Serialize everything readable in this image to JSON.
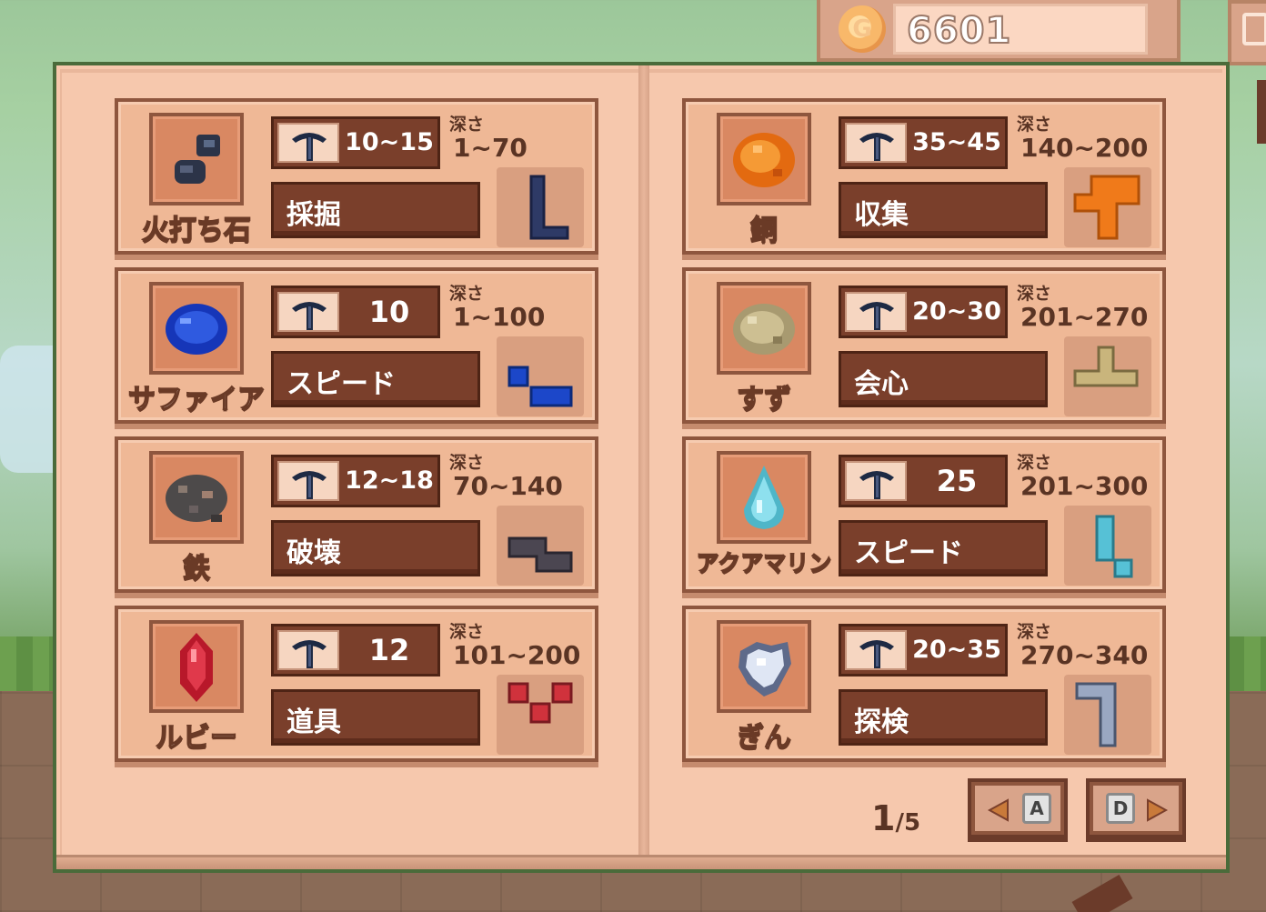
{
  "currency": {
    "amount": "6601",
    "icon": "coin-icon",
    "symbol": "G"
  },
  "depth_label": "深さ",
  "cards": [
    {
      "name": "火打ち石",
      "power": "10~15",
      "depth": "1~70",
      "skill": "採掘",
      "item_icon": "flint-icon",
      "shape_icon": "l-shape-icon",
      "shape_color": "#2e3a66"
    },
    {
      "name": "サファイア",
      "power": "10",
      "depth": "1~100",
      "skill": "スピード",
      "item_icon": "sapphire-icon",
      "shape_icon": "j-shape-icon",
      "shape_color": "#1c47c9"
    },
    {
      "name": "鉄",
      "power": "12~18",
      "depth": "70~140",
      "skill": "破壊",
      "item_icon": "iron-ore-icon",
      "shape_icon": "z-shape-icon",
      "shape_color": "#4b4651"
    },
    {
      "name": "ルビー",
      "power": "12",
      "depth": "101~200",
      "skill": "道具",
      "item_icon": "ruby-icon",
      "shape_icon": "v-shape-icon",
      "shape_color": "#d0323c"
    },
    {
      "name": "銅",
      "power": "35~45",
      "depth": "140~200",
      "skill": "収集",
      "item_icon": "copper-ore-icon",
      "shape_icon": "plus-shape-icon",
      "shape_color": "#f07a1a"
    },
    {
      "name": "すず",
      "power": "20~30",
      "depth": "201~270",
      "skill": "会心",
      "item_icon": "tin-ore-icon",
      "shape_icon": "t-shape-icon",
      "shape_color": "#c9b57c"
    },
    {
      "name": "アクアマリン",
      "power": "25",
      "depth": "201~300",
      "skill": "スピード",
      "item_icon": "aquamarine-icon",
      "shape_icon": "i-shape-icon",
      "shape_color": "#56c1d6"
    },
    {
      "name": "ぎん",
      "power": "20~35",
      "depth": "270~340",
      "skill": "探検",
      "item_icon": "silver-ore-icon",
      "shape_icon": "hook-shape-icon",
      "shape_color": "#9aa8c2"
    }
  ],
  "pager": {
    "current": "1",
    "total": "/5",
    "prev_key": "A",
    "next_key": "D"
  }
}
